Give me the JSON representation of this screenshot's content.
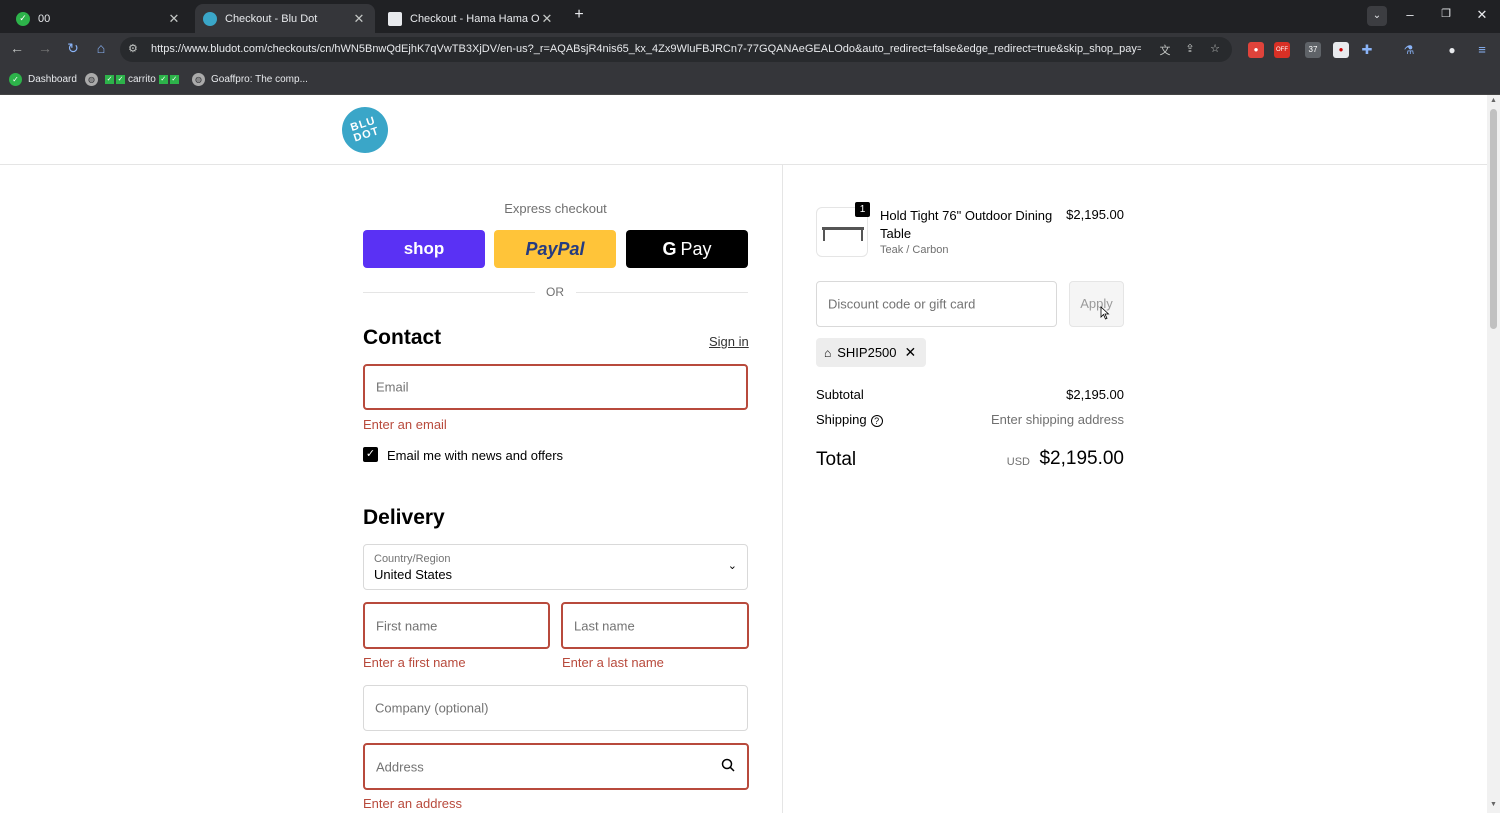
{
  "browser": {
    "tabs": [
      {
        "title": "00",
        "favicon_color": "#2db34a"
      },
      {
        "title": "Checkout - Blu Dot",
        "favicon_color": "#3aa6c8"
      },
      {
        "title": "Checkout - Hama Hama Oyster",
        "favicon_color": "#e8eaed"
      }
    ],
    "url": "https://www.bludot.com/checkouts/cn/hWN5BnwQdEjhK7qVwTB3XjDV/en-us?_r=AQABsjR4nis65_kx_4Zx9WluFBJRCn7-77GQANAeGEALOdo&auto_redirect=false&edge_redirect=true&skip_shop_pay=true",
    "bookmarks": [
      {
        "label": "Dashboard"
      },
      {
        "label": "carrito"
      },
      {
        "label": "Goaffpro: The comp..."
      }
    ]
  },
  "brand": {
    "logo_text_line1": "BLU",
    "logo_text_line2": "DOT",
    "logo_color": "#3aa6c8"
  },
  "express": {
    "label": "Express checkout",
    "shop_label": "shop",
    "paypal_label": "PayPal",
    "gpay_label": "Pay",
    "or_label": "OR"
  },
  "contact": {
    "heading": "Contact",
    "sign_in": "Sign in",
    "email_placeholder": "Email",
    "email_error": "Enter an email",
    "newsletter_label": "Email me with news and offers"
  },
  "delivery": {
    "heading": "Delivery",
    "country_label": "Country/Region",
    "country_value": "United States",
    "first_name_placeholder": "First name",
    "first_name_error": "Enter a first name",
    "last_name_placeholder": "Last name",
    "last_name_error": "Enter a last name",
    "company_placeholder": "Company (optional)",
    "address_placeholder": "Address",
    "address_error": "Enter an address"
  },
  "summary": {
    "item": {
      "quantity": "1",
      "name": "Hold Tight 76\" Outdoor Dining Table",
      "variant": "Teak / Carbon",
      "price": "$2,195.00"
    },
    "discount_placeholder": "Discount code or gift card",
    "apply_label": "Apply",
    "applied_code": "SHIP2500",
    "subtotal_label": "Subtotal",
    "subtotal_value": "$2,195.00",
    "shipping_label": "Shipping",
    "shipping_value": "Enter shipping address",
    "total_label": "Total",
    "total_currency": "USD",
    "total_value": "$2,195.00"
  },
  "colors": {
    "error": "#b84a3c",
    "shop_purple": "#5a31f4",
    "paypal_yellow": "#ffc439"
  }
}
